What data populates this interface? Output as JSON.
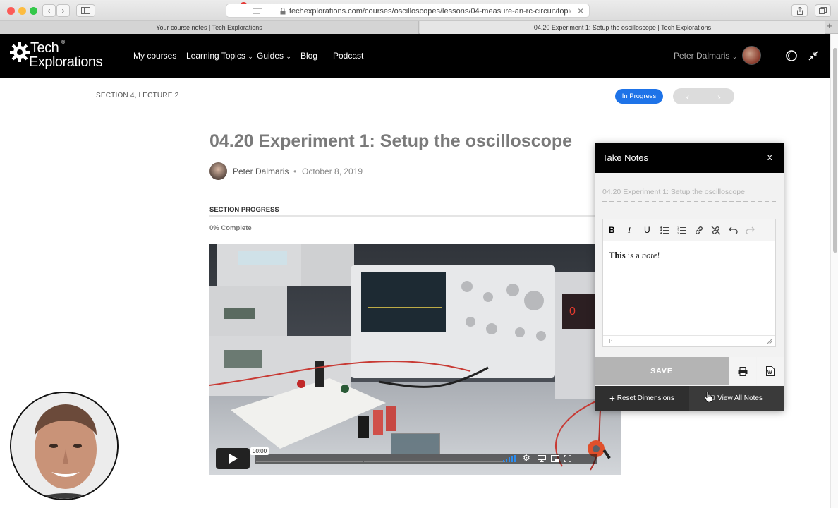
{
  "browser": {
    "url": "techexplorations.com/courses/oscilloscopes/lessons/04-measure-an-rc-circuit/topic/0",
    "dots": "•••",
    "badge": "6",
    "tabs": [
      {
        "title": "Your course notes | Tech Explorations"
      },
      {
        "title": "04.20 Experiment 1: Setup the oscilloscope | Tech Explorations"
      }
    ]
  },
  "site": {
    "logo_line1": "Tech",
    "logo_line2": "Explorations",
    "nav": [
      "My courses",
      "Learning Topics",
      "Guides",
      "Blog",
      "Podcast"
    ],
    "user_name": "Peter Dalmaris"
  },
  "lesson": {
    "breadcrumb": "SECTION 4, LECTURE 2",
    "status": "In Progress",
    "title": "04.20 Experiment 1: Setup the oscilloscope",
    "author": "Peter Dalmaris",
    "date": "October 8, 2019",
    "progress_label": "SECTION PROGRESS",
    "progress_text": "0% Complete",
    "progress_value": 0
  },
  "video": {
    "time": "00:00"
  },
  "notes": {
    "header": "Take Notes",
    "close": "x",
    "title_placeholder": "04.20 Experiment 1: Setup the oscilloscope",
    "note_bold": "This",
    "note_mid": " is a ",
    "note_italic": "note",
    "note_end": "!",
    "path": "P",
    "save": "SAVE",
    "reset": "Reset Dimensions",
    "view_all": "View All Notes"
  },
  "colors": {
    "accent_blue": "#1e73e8",
    "nav_bg": "#000000",
    "save_bg": "#b4b4b4",
    "footer_bg": "#2f2f2f"
  }
}
